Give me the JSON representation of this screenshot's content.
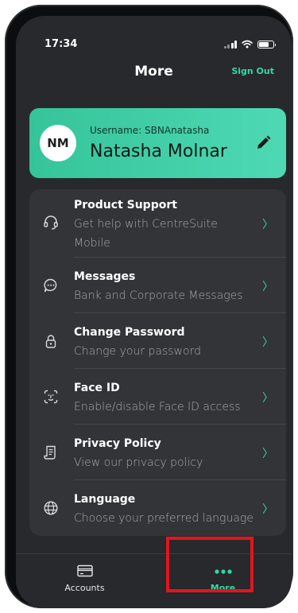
{
  "status": {
    "time": "17:34"
  },
  "header": {
    "title": "More",
    "sign_out": "Sign Out"
  },
  "profile": {
    "initials": "NM",
    "username_label": "Username: SBNAnatasha",
    "full_name": "Natasha Molnar"
  },
  "menu": {
    "items": [
      {
        "title": "Product Support",
        "subtitle": "Get help with CentreSuite Mobile",
        "icon": "headset-icon"
      },
      {
        "title": "Messages",
        "subtitle": "Bank and Corporate Messages",
        "icon": "chat-bubble-icon"
      },
      {
        "title": "Change Password",
        "subtitle": "Change your password",
        "icon": "lock-icon"
      },
      {
        "title": "Face ID",
        "subtitle": "Enable/disable Face ID access",
        "icon": "face-id-icon"
      },
      {
        "title": "Privacy Policy",
        "subtitle": "View our privacy policy",
        "icon": "document-icon"
      },
      {
        "title": "Language",
        "subtitle": "Choose your preferred language",
        "icon": "globe-icon"
      }
    ],
    "chevron": "〉"
  },
  "tabs": {
    "accounts": "Accounts",
    "more": "More"
  },
  "colors": {
    "accent": "#37d6a3",
    "background": "#27292c",
    "card": "#323438",
    "highlight": "#e4141c"
  }
}
